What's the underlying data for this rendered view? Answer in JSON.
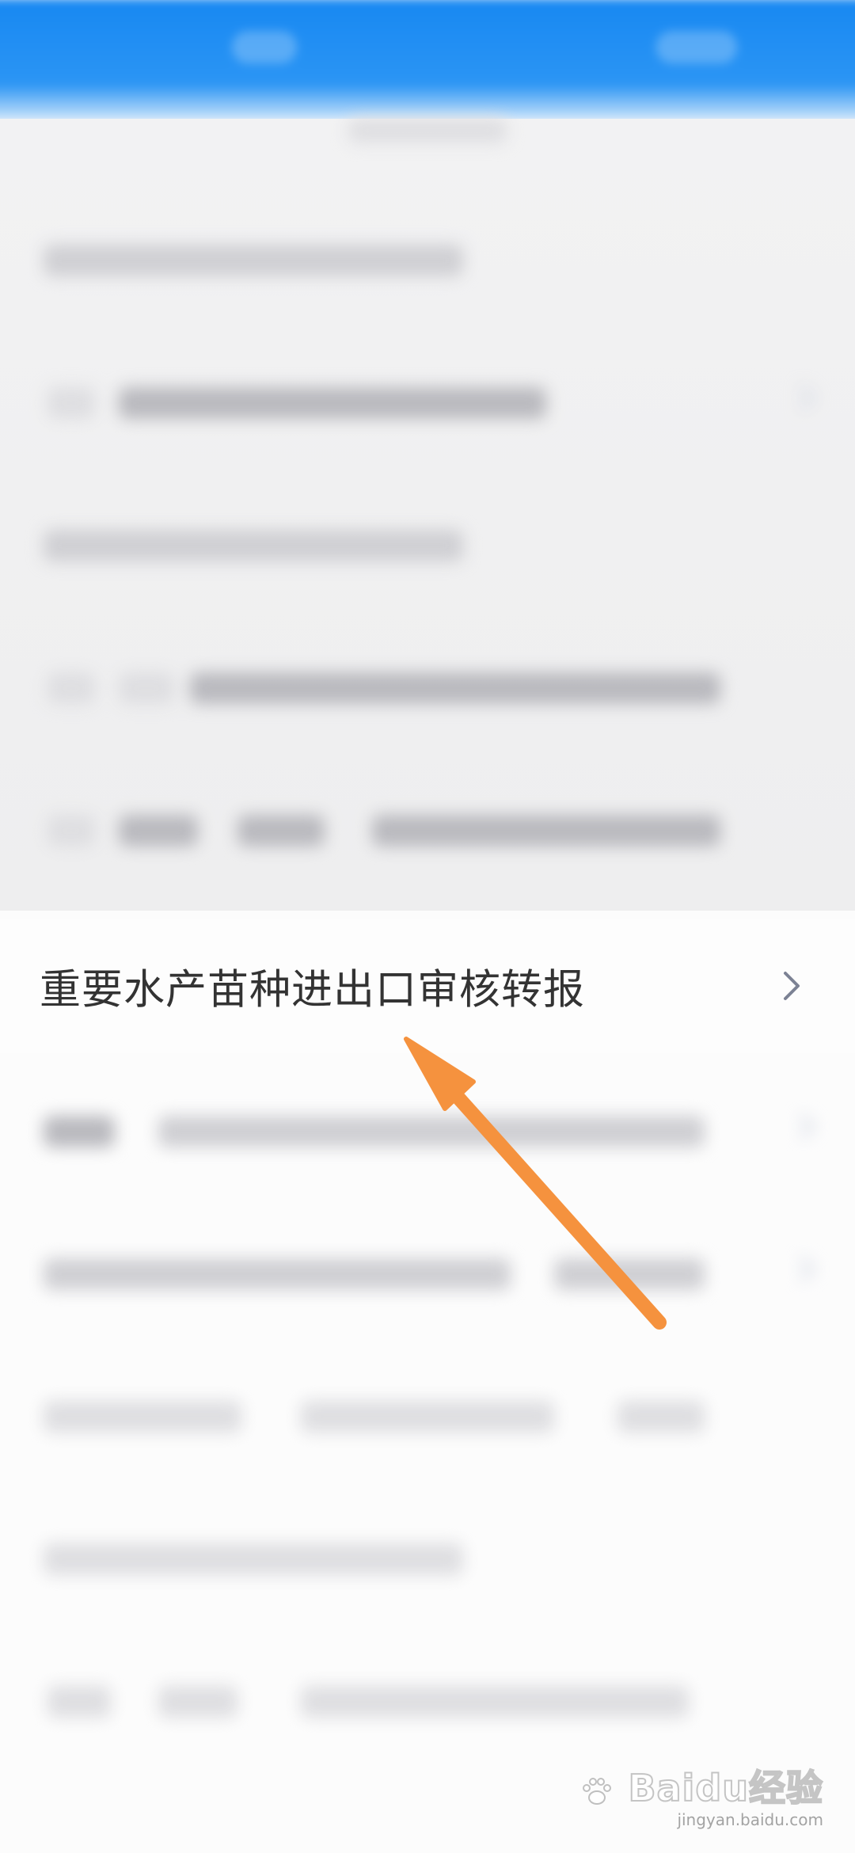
{
  "focused_item": {
    "label": "重要水产苗种进出口审核转报",
    "chevron_icon": "chevron-right-icon"
  },
  "annotation": {
    "arrow_color": "#f5923e",
    "icon": "arrow-pointer-icon"
  },
  "watermark": {
    "logo_text": "Baidu经验",
    "url": "jingyan.baidu.com"
  },
  "colors": {
    "header_blue": "#1788f2",
    "label_text": "#333333",
    "chevron": "#7c8294"
  }
}
